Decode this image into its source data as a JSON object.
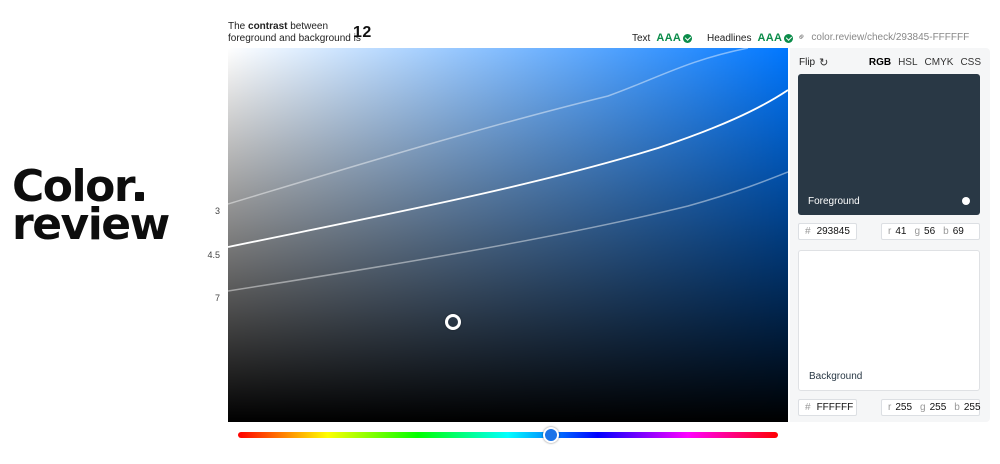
{
  "logo": {
    "line1": "Color",
    "line2": "review"
  },
  "contrast": {
    "line1_prefix": "The ",
    "line1_bold": "contrast",
    "line1_suffix": " between",
    "line2": "foreground and background is",
    "value": "12"
  },
  "ratings": [
    {
      "label": "Text",
      "grade": "AAA"
    },
    {
      "label": "Headlines",
      "grade": "AAA"
    }
  ],
  "share_link": "color.review/check/293845-FFFFFF",
  "picker": {
    "curve_labels": [
      "3",
      "4.5",
      "7"
    ],
    "hue_value": 0.58
  },
  "panel": {
    "flip_label": "Flip",
    "modes": [
      "RGB",
      "HSL",
      "CMYK",
      "CSS"
    ],
    "active_mode": "RGB",
    "foreground": {
      "label": "Foreground",
      "color": "#293845",
      "hex_prefix": "#",
      "hex": "293845",
      "r_label": "r",
      "r": "41",
      "g_label": "g",
      "g": "56",
      "b_label": "b",
      "b": "69"
    },
    "background": {
      "label": "Background",
      "color": "#FFFFFF",
      "hex_prefix": "#",
      "hex": "FFFFFF",
      "r_label": "r",
      "r": "255",
      "g_label": "g",
      "g": "255",
      "b_label": "b",
      "b": "255"
    }
  },
  "colors": {
    "pass": "#0B8C4A",
    "accent": "#0077FF"
  }
}
